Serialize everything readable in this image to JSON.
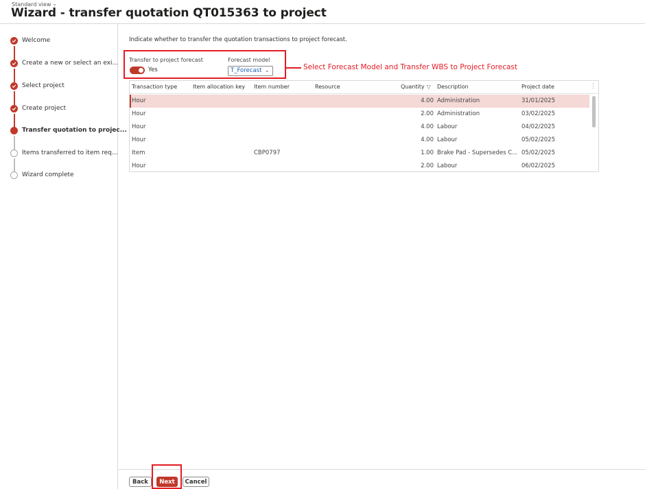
{
  "header": {
    "view_label": "Standard view",
    "title": "Wizard - transfer quotation QT015363 to project"
  },
  "steps": [
    {
      "label": "Welcome",
      "status": "done"
    },
    {
      "label": "Create a new or select an exi...",
      "status": "done"
    },
    {
      "label": "Select project",
      "status": "done"
    },
    {
      "label": "Create project",
      "status": "done"
    },
    {
      "label": "Transfer quotation to projec...",
      "status": "active"
    },
    {
      "label": "Items transferred to item req...",
      "status": "pending"
    },
    {
      "label": "Wizard complete",
      "status": "pending"
    }
  ],
  "main": {
    "instruction": "Indicate whether to transfer the quotation transactions to project forecast.",
    "transfer_label": "Transfer to project forecast",
    "transfer_value": "Yes",
    "transfer_on": true,
    "forecast_model_label": "Forecast model",
    "forecast_model_value": "T_Forecast",
    "annotation": "Select Forecast Model and Transfer WBS to Project Forecast"
  },
  "grid": {
    "columns": [
      "Transaction type",
      "Item allocation key",
      "Item number",
      "Resource",
      "Quantity",
      "Description",
      "Project date"
    ],
    "rows": [
      {
        "type": "Hour",
        "alloc": "",
        "item": "",
        "resource": "",
        "qty": "4.00",
        "desc": "Administration",
        "date": "31/01/2025",
        "selected": true
      },
      {
        "type": "Hour",
        "alloc": "",
        "item": "",
        "resource": "",
        "qty": "2.00",
        "desc": "Administration",
        "date": "03/02/2025"
      },
      {
        "type": "Hour",
        "alloc": "",
        "item": "",
        "resource": "",
        "qty": "4.00",
        "desc": "Labour",
        "date": "04/02/2025"
      },
      {
        "type": "Hour",
        "alloc": "",
        "item": "",
        "resource": "",
        "qty": "4.00",
        "desc": "Labour",
        "date": "05/02/2025"
      },
      {
        "type": "Item",
        "alloc": "",
        "item": "CBP0797",
        "resource": "",
        "qty": "1.00",
        "desc": "Brake Pad - Supersedes C...",
        "date": "05/02/2025"
      },
      {
        "type": "Hour",
        "alloc": "",
        "item": "",
        "resource": "",
        "qty": "2.00",
        "desc": "Labour",
        "date": "06/02/2025"
      }
    ]
  },
  "footer": {
    "back_label": "Back",
    "next_label": "Next",
    "cancel_label": "Cancel"
  },
  "colors": {
    "accent": "#c0392b",
    "annotation": "#e31b23",
    "selected_row": "#f4d9d6"
  }
}
